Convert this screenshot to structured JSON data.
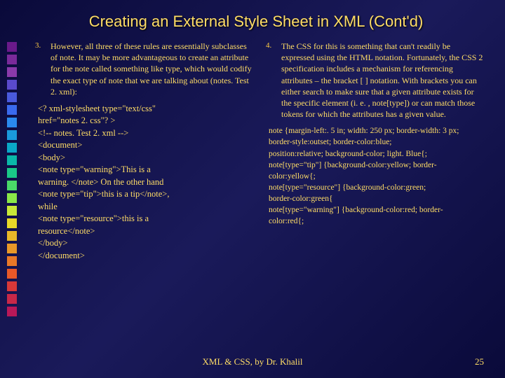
{
  "title": "Creating an External Style Sheet in XML (Cont'd)",
  "left": {
    "num": "3.",
    "para": "However, all three of these rules are essentially subclasses of note. It may be more advantageous to create an attribute for the note called something like type, which would codify the exact type of note that we are talking about (notes. Test 2. xml):",
    "code": [
      "<? xml-stylesheet type=\"text/css\"",
      "      href=\"notes 2. css\"? >",
      "<!-- notes. Test 2. xml -->",
      "<document>",
      "  <body>",
      "   <note type=\"warning\">This is a",
      "      warning. </note> On the other hand",
      "   <note type=\"tip\">this is a tip</note>,",
      "      while",
      "   <note type=\"resource\">this is a",
      "      resource</note>",
      "  </body>",
      "",
      " </document>"
    ]
  },
  "right": {
    "num": "4.",
    "para": "The CSS for this is something that can't readily be expressed using the HTML notation. Fortunately, the CSS 2 specification includes a mechanism for referencing attributes – the bracket [ ] notation. With brackets you can either search to make sure that a given attribute exists for the specific element (i. e. , note[type]) or can match those tokens for which the attributes has a given value.",
    "css": [
      "note {margin-left:. 5 in; width: 250 px; border-width: 3 px;",
      "        border-style:outset; border-color:blue;",
      "        position:relative; background-color; light. Blue{;",
      "    note[type=\"tip\"]  {background-color:yellow; border-",
      "        color:yellow{;",
      "    note[type=\"resource\"] {background-color:green;",
      "    border-color:green{",
      "    note[type=\"warning\"] {background-color:red; border-",
      "        color:red{;"
    ]
  },
  "footer": "XML & CSS, by Dr. Khalil",
  "page": "25",
  "decor_colors": [
    "#6a1a8a",
    "#7a2a9a",
    "#8a3aaa",
    "#5a4acc",
    "#4a5add",
    "#3a6aee",
    "#2a8aee",
    "#1a9adc",
    "#0aa8c8",
    "#0ab8a8",
    "#1ac888",
    "#4ad868",
    "#8ae848",
    "#c8e838",
    "#e8d828",
    "#e8b828",
    "#e89828",
    "#e87828",
    "#e85828",
    "#d83838",
    "#c82848",
    "#b81858"
  ]
}
